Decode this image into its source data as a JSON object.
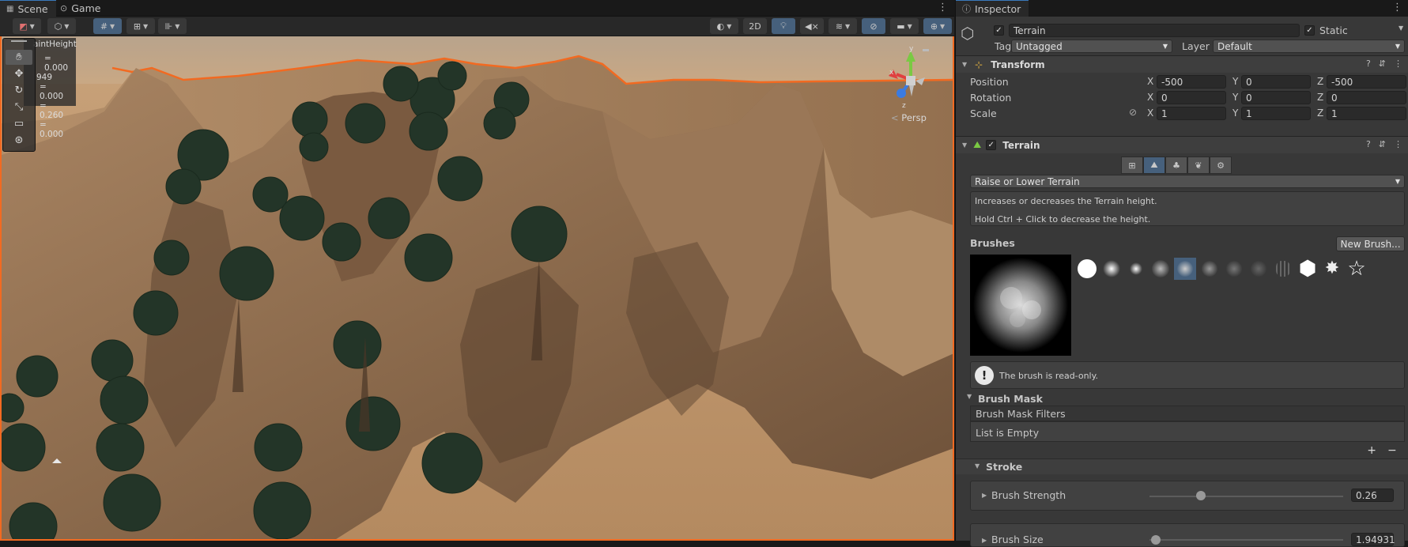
{
  "scene_tabs": {
    "scene": "Scene",
    "game": "Game"
  },
  "scene_toolbar": {
    "mode_2d": "2D"
  },
  "overlay": {
    "title": "aintHeight",
    "lines": [
      "= 0.000",
      "949",
      "= 0.000",
      "= 0.260",
      "= 0.000"
    ]
  },
  "gizmo": {
    "persp_label": "Persp",
    "axis_y": "y",
    "axis_x": "x",
    "axis_z": "z"
  },
  "inspector": {
    "tab": "Inspector",
    "object_name": "Terrain",
    "static_label": "Static",
    "tag_label": "Tag",
    "tag_value": "Untagged",
    "layer_label": "Layer",
    "layer_value": "Default",
    "transform": {
      "title": "Transform",
      "position_label": "Position",
      "rotation_label": "Rotation",
      "scale_label": "Scale",
      "position": {
        "x": "-500",
        "y": "0",
        "z": "-500"
      },
      "rotation": {
        "x": "0",
        "y": "0",
        "z": "0"
      },
      "scale": {
        "x": "1",
        "y": "1",
        "z": "1"
      },
      "axis_x": "X",
      "axis_y": "Y",
      "axis_z": "Z"
    },
    "terrain": {
      "title": "Terrain",
      "mode": "Raise or Lower Terrain",
      "help_line1": "Increases or decreases the Terrain height.",
      "help_line2": "Hold Ctrl + Click to decrease the height.",
      "brushes_label": "Brushes",
      "new_brush": "New Brush...",
      "read_only_note": "The brush is read-only.",
      "brush_mask_title": "Brush Mask",
      "brush_mask_filters": "Brush Mask Filters",
      "list_empty": "List is Empty",
      "add": "+",
      "remove": "−",
      "stroke_title": "Stroke",
      "brush_strength_label": "Brush Strength",
      "brush_strength_value": "0.26",
      "brush_size_label": "Brush Size",
      "brush_size_value": "1.94931"
    }
  },
  "colors": {
    "accent_blue": "#46607c",
    "selection_orange": "#f26a21"
  },
  "icons": [
    "scene-grid-icon",
    "gamepad-icon",
    "cube-icon",
    "hand-tool-icon",
    "move-tool-icon",
    "rotate-tool-icon",
    "scale-tool-icon",
    "rect-tool-icon",
    "transform-tool-icon",
    "help-icon",
    "preset-icon",
    "kebab-menu-icon",
    "warning-icon",
    "link-icon"
  ]
}
